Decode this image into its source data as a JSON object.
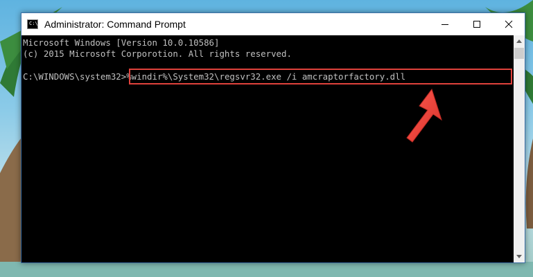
{
  "window": {
    "title": "Administrator: Command Prompt",
    "icon_label": "C:\\_"
  },
  "console": {
    "lines": [
      "Microsoft Windows [Version 10.0.10586]",
      "(c) 2015 Microsoft Corporotion. All rights reserved."
    ],
    "prompt": "C:\\WINDOWS\\system32>",
    "command": "%windir%\\System32\\regsvr32.exe /i amcraptorfactory.dll"
  },
  "colors": {
    "highlight": "#e0423c",
    "console_text": "#c0c0c0",
    "console_bg": "#000000"
  },
  "icons": [
    "cmd-icon",
    "minimize-icon",
    "maximize-icon",
    "close-icon",
    "scroll-up-icon",
    "scroll-down-icon",
    "pointer-arrow-icon"
  ]
}
